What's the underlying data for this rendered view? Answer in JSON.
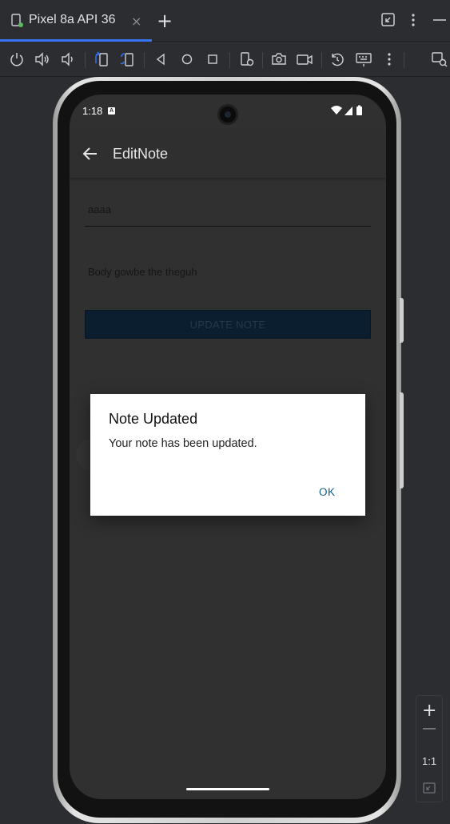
{
  "ide": {
    "tab_title": "Pixel 8a API 36",
    "tab_close": "×",
    "tab_add": "+"
  },
  "toolbar_icons": [
    "power-icon",
    "volume-up-icon",
    "volume-down-icon",
    "rotate-left-icon",
    "rotate-right-icon",
    "back-icon",
    "home-icon",
    "overview-icon",
    "device-settings-icon",
    "screenshot-icon",
    "screen-record-icon",
    "snapshot-icon",
    "keyboard-icon",
    "more-icon",
    "device-explorer-icon"
  ],
  "phone": {
    "status": {
      "time": "1:18",
      "badge": "A"
    },
    "app_bar": {
      "title": "EditNote"
    },
    "form": {
      "title_value": "aaaa",
      "body_value": "Body gowbe the theguh",
      "update_button": "UPDATE NOTE"
    },
    "dialog": {
      "title": "Note Updated",
      "message": "Your note has been updated.",
      "ok_button": "OK"
    }
  },
  "zoom": {
    "plus": "+",
    "ratio": "1:1"
  },
  "colors": {
    "accent": "#3574f0",
    "dialog_button": "#0f5f8f",
    "screen_bg": "#303030"
  }
}
